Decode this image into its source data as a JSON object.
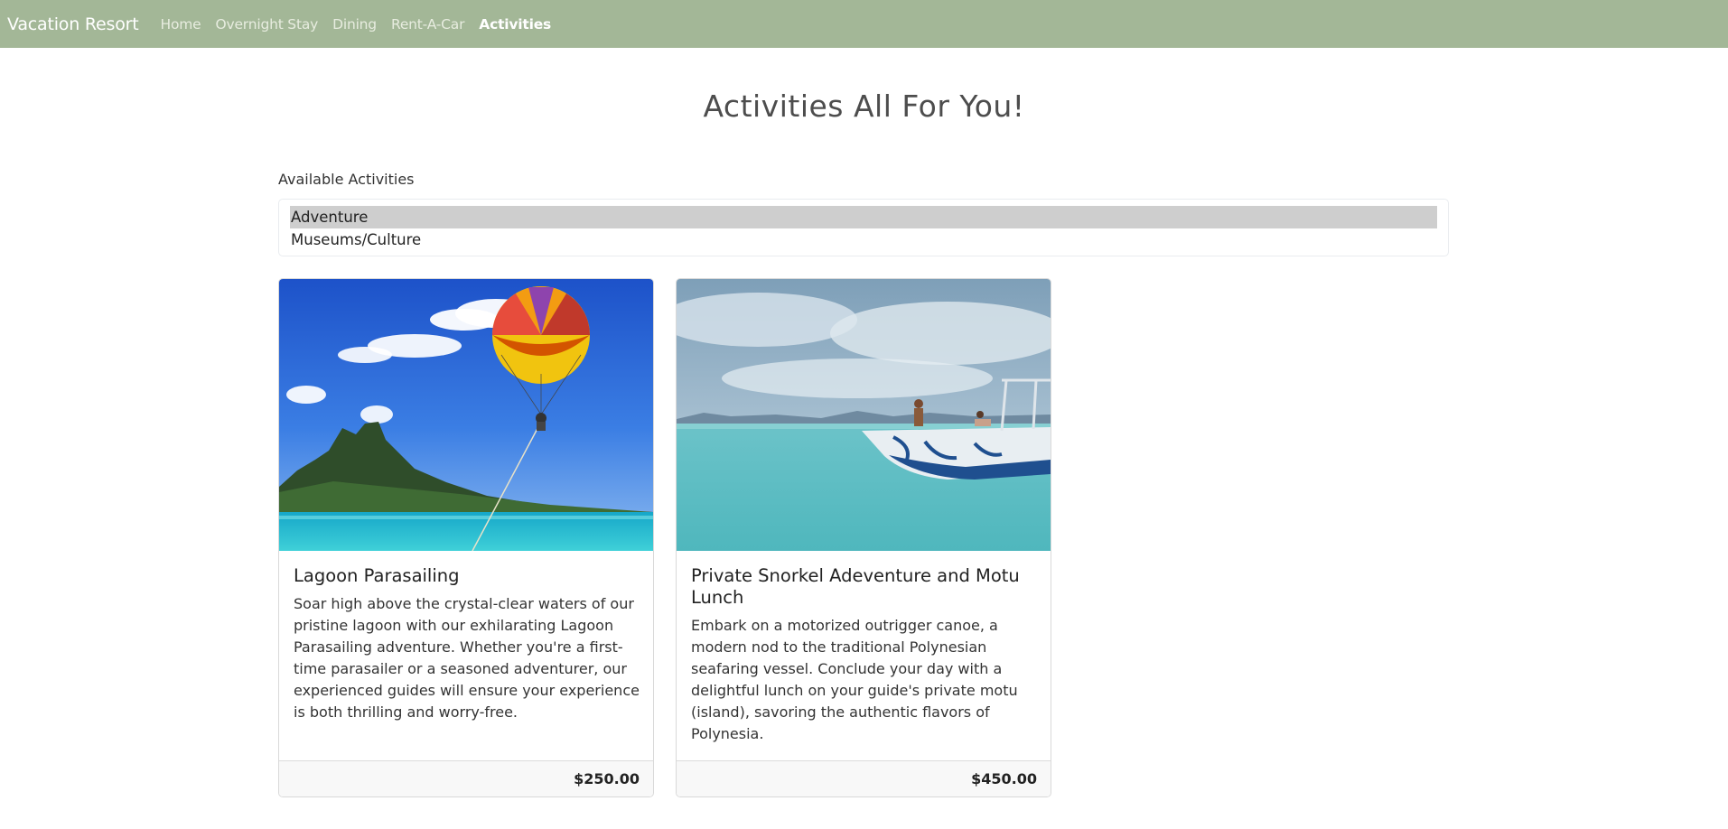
{
  "navbar": {
    "brand": "Vacation Resort",
    "links": [
      "Home",
      "Overnight Stay",
      "Dining",
      "Rent-A-Car",
      "Activities"
    ],
    "active": "Activities"
  },
  "page": {
    "title": "Activities All For You!"
  },
  "filter": {
    "label": "Available Activities",
    "options": [
      "Adventure",
      "Museums/Culture"
    ],
    "selected": "Adventure"
  },
  "cards": [
    {
      "title": "Lagoon Parasailing",
      "text": "Soar high above the crystal-clear waters of our pristine lagoon with our exhilarating Lagoon Parasailing adventure. Whether you're a first-time parasailer or a seasoned adventurer, our experienced guides will ensure your experience is both thrilling and worry-free.",
      "price": "$250.00"
    },
    {
      "title": "Private Snorkel Adeventure and Motu Lunch",
      "text": "Embark on a motorized outrigger canoe, a modern nod to the traditional Polynesian seafaring vessel. Conclude your day with a delightful lunch on your guide's private motu (island), savoring the authentic flavors of Polynesia.",
      "price": "$450.00"
    }
  ],
  "colors": {
    "navbar": "#a3b797",
    "selected_option": "#cecece"
  }
}
